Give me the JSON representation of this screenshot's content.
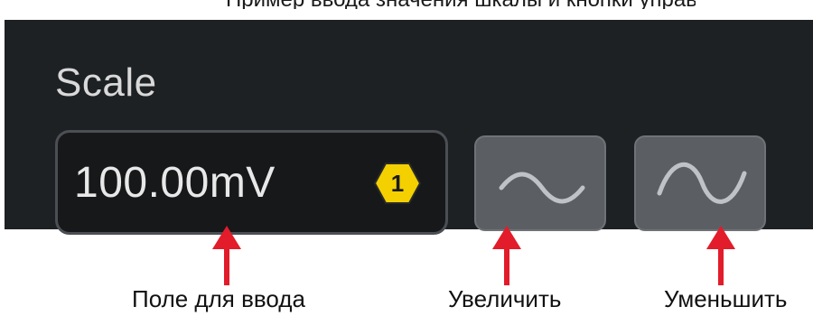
{
  "header": {
    "caption": "Пример ввода значения шкалы и кнопки управления"
  },
  "panel": {
    "title": "Scale",
    "value_field": {
      "value": "100.00mV",
      "badge": "1"
    },
    "buttons": [
      {
        "name": "increase",
        "icon": "wave-small-icon"
      },
      {
        "name": "decrease",
        "icon": "wave-large-icon"
      }
    ]
  },
  "annotations": {
    "input_label": "Поле для ввода",
    "increase_label": "Увеличить",
    "decrease_label": "Уменьшить"
  },
  "colors": {
    "panel_bg": "#1e2124",
    "field_bg": "#16181a",
    "button_bg": "#5b5f63",
    "badge": "#f4d000",
    "arrow": "#e21c2a"
  }
}
